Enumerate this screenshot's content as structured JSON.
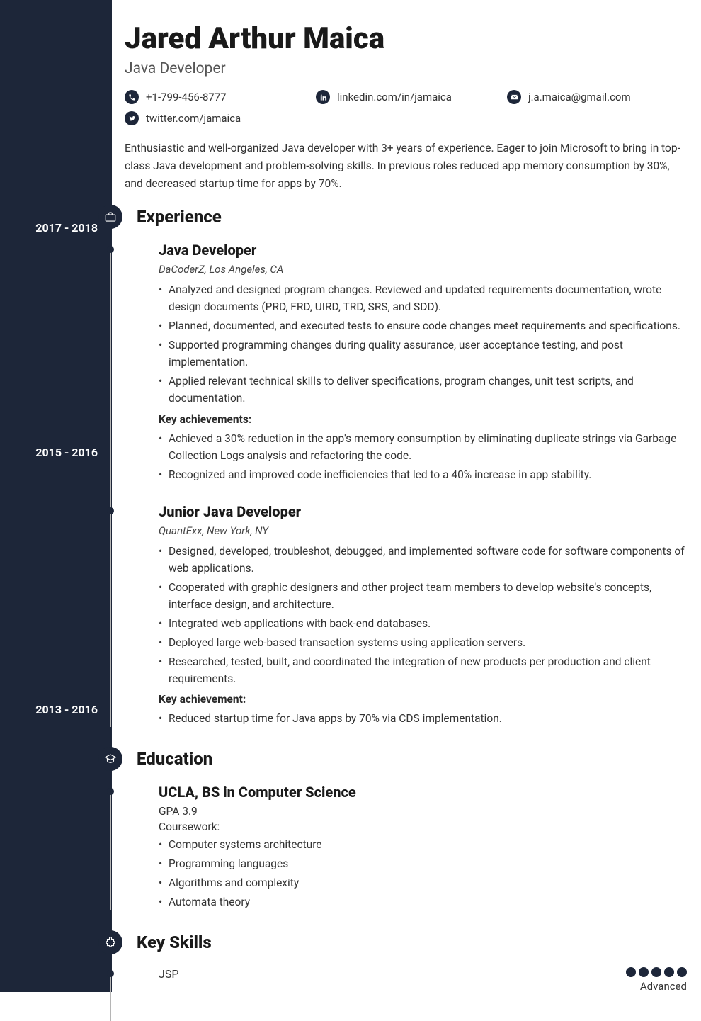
{
  "header": {
    "name": "Jared Arthur Maica",
    "title": "Java Developer"
  },
  "contacts": {
    "phone": "+1-799-456-8777",
    "linkedin": "linkedin.com/in/jamaica",
    "email": "j.a.maica@gmail.com",
    "twitter": "twitter.com/jamaica"
  },
  "summary": "Enthusiastic and well-organized Java developer with 3+ years of experience. Eager to join Microsoft to bring in top-class Java development and problem-solving skills. In previous roles reduced app memory consumption by 30%, and decreased startup time for apps by 70%.",
  "sections": {
    "experience_heading": "Experience",
    "education_heading": "Education",
    "skills_heading": "Key Skills"
  },
  "experience": [
    {
      "dates": "2017 - 2018",
      "role": "Java Developer",
      "company": "DaCoderZ, Los Angeles, CA",
      "bullets": [
        "Analyzed and designed program changes. Reviewed and updated requirements documentation, wrote design documents (PRD, FRD, UIRD, TRD, SRS, and SDD).",
        "Planned, documented, and executed tests to ensure code changes meet requirements and specifications.",
        "Supported programming changes during quality assurance, user acceptance testing, and post implementation.",
        "Applied relevant technical skills to deliver specifications, program changes, unit test scripts, and documentation."
      ],
      "achievements_label": "Key achievements:",
      "achievements": [
        "Achieved a 30% reduction in the app's memory consumption by eliminating duplicate strings via Garbage Collection Logs analysis and refactoring the code.",
        "Recognized and improved code inefficiencies that led to a 40% increase in app stability."
      ]
    },
    {
      "dates": "2015 - 2016",
      "role": "Junior Java Developer",
      "company": "QuantExx, New York, NY",
      "bullets": [
        "Designed, developed, troubleshot, debugged, and implemented software code for software components of web applications.",
        "Cooperated with graphic designers and other project team members to develop website's concepts, interface design, and architecture.",
        "Integrated web applications with back-end databases.",
        "Deployed large web-based transaction systems using application servers.",
        "Researched, tested, built, and coordinated the integration of new products per production and client requirements."
      ],
      "achievements_label": "Key achievement:",
      "achievements": [
        "Reduced startup time for Java apps by 70% via CDS implementation."
      ]
    }
  ],
  "education": [
    {
      "dates": "2013 - 2016",
      "degree": "UCLA, BS in Computer Science",
      "gpa": "GPA 3.9",
      "coursework_label": "Coursework:",
      "courses": [
        "Computer systems architecture",
        "Programming languages",
        "Algorithms and complexity",
        "Automata theory"
      ]
    }
  ],
  "skills": [
    {
      "name": "JSP",
      "level": "Advanced",
      "rating": 5
    }
  ]
}
